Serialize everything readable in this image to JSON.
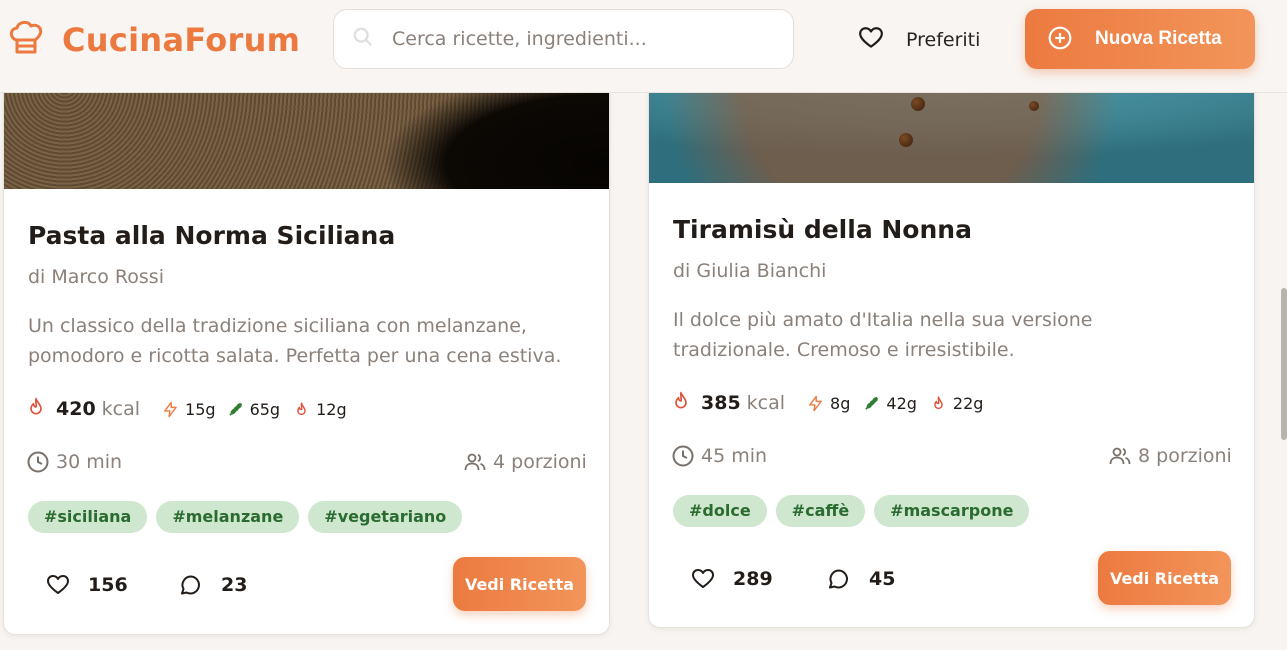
{
  "header": {
    "app_name": "CucinaForum",
    "search_placeholder": "Cerca ricette, ingredienti...",
    "favorites_label": "Preferiti",
    "new_recipe_label": "Nuova Ricetta"
  },
  "colors": {
    "brand": "#ec7a40",
    "tag_bg": "#cfe6cf",
    "tag_text": "#2a6b2f"
  },
  "recipes": [
    {
      "title": "Pasta alla Norma Siciliana",
      "author": "di Marco Rossi",
      "description": "Un classico della tradizione siciliana con melanzane, pomodoro e ricotta salata. Perfetta per una cena estiva.",
      "kcal": "420",
      "kcal_unit": "kcal",
      "protein": "15g",
      "carbs": "65g",
      "fat": "12g",
      "time": "30 min",
      "servings": "4 porzioni",
      "tags": [
        "#siciliana",
        "#melanzane",
        "#vegetariano"
      ],
      "likes": "156",
      "comments": "23",
      "button_label": "Vedi Ricetta"
    },
    {
      "title": "Tiramisù della Nonna",
      "author": "di Giulia Bianchi",
      "description": "Il dolce più amato d'Italia nella sua versione tradizionale. Cremoso e irresistibile.",
      "kcal": "385",
      "kcal_unit": "kcal",
      "protein": "8g",
      "carbs": "42g",
      "fat": "22g",
      "time": "45 min",
      "servings": "8 porzioni",
      "tags": [
        "#dolce",
        "#caffè",
        "#mascarpone"
      ],
      "likes": "289",
      "comments": "45",
      "button_label": "Vedi Ricetta"
    }
  ]
}
